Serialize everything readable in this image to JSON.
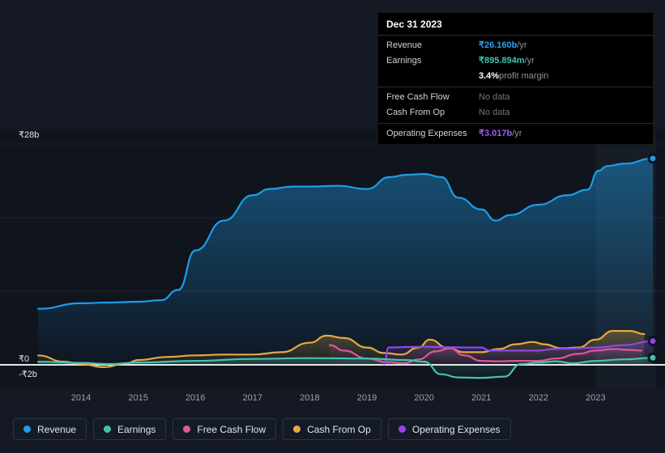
{
  "tooltip": {
    "date": "Dec 31 2023",
    "revenue": {
      "label": "Revenue",
      "value": "₹26.160b",
      "suffix": " /yr",
      "color": "#2aa3ef"
    },
    "earnings": {
      "label": "Earnings",
      "value": "₹895.894m",
      "suffix": " /yr",
      "color": "#43c3ae"
    },
    "margin": {
      "value": "3.4%",
      "suffix": " profit margin"
    },
    "free_cash_flow": {
      "label": "Free Cash Flow",
      "value": "No data"
    },
    "cash_from_op": {
      "label": "Cash From Op",
      "value": "No data"
    },
    "operating_expenses": {
      "label": "Operating Expenses",
      "value": "₹3.017b",
      "suffix": " /yr",
      "color": "#a05ef0"
    }
  },
  "legend": {
    "items": [
      {
        "label": "Revenue",
        "color": "#1f9ce8"
      },
      {
        "label": "Earnings",
        "color": "#43c3ae"
      },
      {
        "label": "Free Cash Flow",
        "color": "#e0569d"
      },
      {
        "label": "Cash From Op",
        "color": "#e5a944"
      },
      {
        "label": "Operating Expenses",
        "color": "#8f45e8"
      }
    ]
  },
  "chart_data": {
    "type": "area",
    "title": "",
    "x_ticks": [
      2014,
      2015,
      2016,
      2017,
      2018,
      2019,
      2020,
      2021,
      2022,
      2023
    ],
    "y_axis": {
      "top_label": "₹28b",
      "zero_label": "₹0",
      "bottom_label": "-₹2b",
      "unit": "₹ billions",
      "top_value": 28,
      "bottom_value": -2
    },
    "gridline_values": [
      28,
      18.67,
      9.33
    ],
    "highlight_band": {
      "from": 2023.0,
      "to": 2024.05
    },
    "series": [
      {
        "id": "revenue",
        "name": "Revenue",
        "color": "#1f9ce8",
        "fill_top": 0.45,
        "end_dot": true,
        "points": [
          [
            2013.25,
            7.1
          ],
          [
            2014,
            7.8
          ],
          [
            2014.5,
            7.9
          ],
          [
            2015,
            8.0
          ],
          [
            2015.4,
            8.2
          ],
          [
            2015.7,
            9.5
          ],
          [
            2016,
            14.5
          ],
          [
            2016.5,
            18.3
          ],
          [
            2017,
            21.5
          ],
          [
            2017.3,
            22.3
          ],
          [
            2017.7,
            22.6
          ],
          [
            2018,
            22.6
          ],
          [
            2018.5,
            22.7
          ],
          [
            2019,
            22.3
          ],
          [
            2019.4,
            23.8
          ],
          [
            2019.7,
            24.1
          ],
          [
            2020,
            24.2
          ],
          [
            2020.3,
            23.8
          ],
          [
            2020.6,
            21.2
          ],
          [
            2021,
            19.7
          ],
          [
            2021.25,
            18.3
          ],
          [
            2021.5,
            19.0
          ],
          [
            2022,
            20.3
          ],
          [
            2022.5,
            21.5
          ],
          [
            2022.85,
            22.2
          ],
          [
            2023.05,
            24.6
          ],
          [
            2023.2,
            25.2
          ],
          [
            2023.5,
            25.5
          ],
          [
            2024,
            26.16
          ]
        ]
      },
      {
        "id": "earnings",
        "name": "Earnings",
        "color": "#43c3ae",
        "fill_top": 0.25,
        "end_dot": true,
        "points": [
          [
            2013.25,
            0.4
          ],
          [
            2014,
            0.25
          ],
          [
            2014.5,
            0.1
          ],
          [
            2015,
            0.3
          ],
          [
            2016,
            0.5
          ],
          [
            2017,
            0.75
          ],
          [
            2018,
            0.85
          ],
          [
            2019,
            0.8
          ],
          [
            2019.7,
            0.6
          ],
          [
            2020,
            0.4
          ],
          [
            2020.3,
            -1.2
          ],
          [
            2020.6,
            -1.6
          ],
          [
            2021,
            -1.65
          ],
          [
            2021.4,
            -1.5
          ],
          [
            2021.7,
            0.1
          ],
          [
            2022,
            0.3
          ],
          [
            2022.3,
            0.45
          ],
          [
            2022.6,
            0.2
          ],
          [
            2023,
            0.5
          ],
          [
            2023.5,
            0.7
          ],
          [
            2024,
            0.896
          ]
        ]
      },
      {
        "id": "free-cash-flow",
        "name": "Free Cash Flow",
        "color": "#e0569d",
        "fill_top": 0.15,
        "end_dot": false,
        "points": [
          [
            2018.35,
            2.5
          ],
          [
            2018.6,
            1.8
          ],
          [
            2019,
            0.8
          ],
          [
            2019.35,
            0.35
          ],
          [
            2019.65,
            0.2
          ],
          [
            2019.9,
            0.7
          ],
          [
            2020.2,
            1.7
          ],
          [
            2020.45,
            2.1
          ],
          [
            2020.7,
            1.2
          ],
          [
            2021,
            0.5
          ],
          [
            2021.3,
            0.45
          ],
          [
            2021.6,
            0.5
          ],
          [
            2022,
            0.5
          ],
          [
            2022.3,
            0.8
          ],
          [
            2022.7,
            1.4
          ],
          [
            2023,
            1.8
          ],
          [
            2023.3,
            2.0
          ],
          [
            2023.6,
            1.9
          ],
          [
            2023.8,
            1.8
          ]
        ]
      },
      {
        "id": "cash-from-op",
        "name": "Cash From Op",
        "color": "#e5a944",
        "fill_top": 0.3,
        "end_dot": false,
        "points": [
          [
            2013.25,
            1.2
          ],
          [
            2013.7,
            0.4
          ],
          [
            2014,
            0.1
          ],
          [
            2014.4,
            -0.3
          ],
          [
            2014.8,
            0.2
          ],
          [
            2015,
            0.6
          ],
          [
            2015.5,
            1.0
          ],
          [
            2016,
            1.2
          ],
          [
            2016.5,
            1.3
          ],
          [
            2017,
            1.3
          ],
          [
            2017.5,
            1.6
          ],
          [
            2018,
            2.8
          ],
          [
            2018.3,
            3.7
          ],
          [
            2018.6,
            3.4
          ],
          [
            2019,
            2.2
          ],
          [
            2019.3,
            1.5
          ],
          [
            2019.6,
            1.3
          ],
          [
            2019.9,
            2.2
          ],
          [
            2020.1,
            3.2
          ],
          [
            2020.4,
            2.2
          ],
          [
            2020.7,
            1.6
          ],
          [
            2021,
            1.6
          ],
          [
            2021.3,
            2.0
          ],
          [
            2021.6,
            2.6
          ],
          [
            2021.9,
            2.9
          ],
          [
            2022.1,
            2.6
          ],
          [
            2022.4,
            2.1
          ],
          [
            2022.7,
            2.2
          ],
          [
            2023,
            3.2
          ],
          [
            2023.3,
            4.3
          ],
          [
            2023.6,
            4.3
          ],
          [
            2023.85,
            3.9
          ]
        ]
      },
      {
        "id": "operating-expenses",
        "name": "Operating Expenses",
        "color": "#8f45e8",
        "fill_top": 0.25,
        "end_dot": true,
        "points": [
          [
            2019.3,
            0.1
          ],
          [
            2019.38,
            2.2
          ],
          [
            2019.6,
            2.25
          ],
          [
            2020,
            2.3
          ],
          [
            2020.4,
            2.25
          ],
          [
            2020.8,
            2.2
          ],
          [
            2021,
            2.2
          ],
          [
            2021.15,
            1.8
          ],
          [
            2021.5,
            1.8
          ],
          [
            2022,
            1.8
          ],
          [
            2022.25,
            2.0
          ],
          [
            2022.5,
            2.05
          ],
          [
            2023,
            2.2
          ],
          [
            2023.5,
            2.5
          ],
          [
            2024,
            3.017
          ]
        ]
      }
    ]
  },
  "colors": {
    "background": "#141923",
    "panel": "#0f141d",
    "zero_line": "#e4e7ea"
  }
}
